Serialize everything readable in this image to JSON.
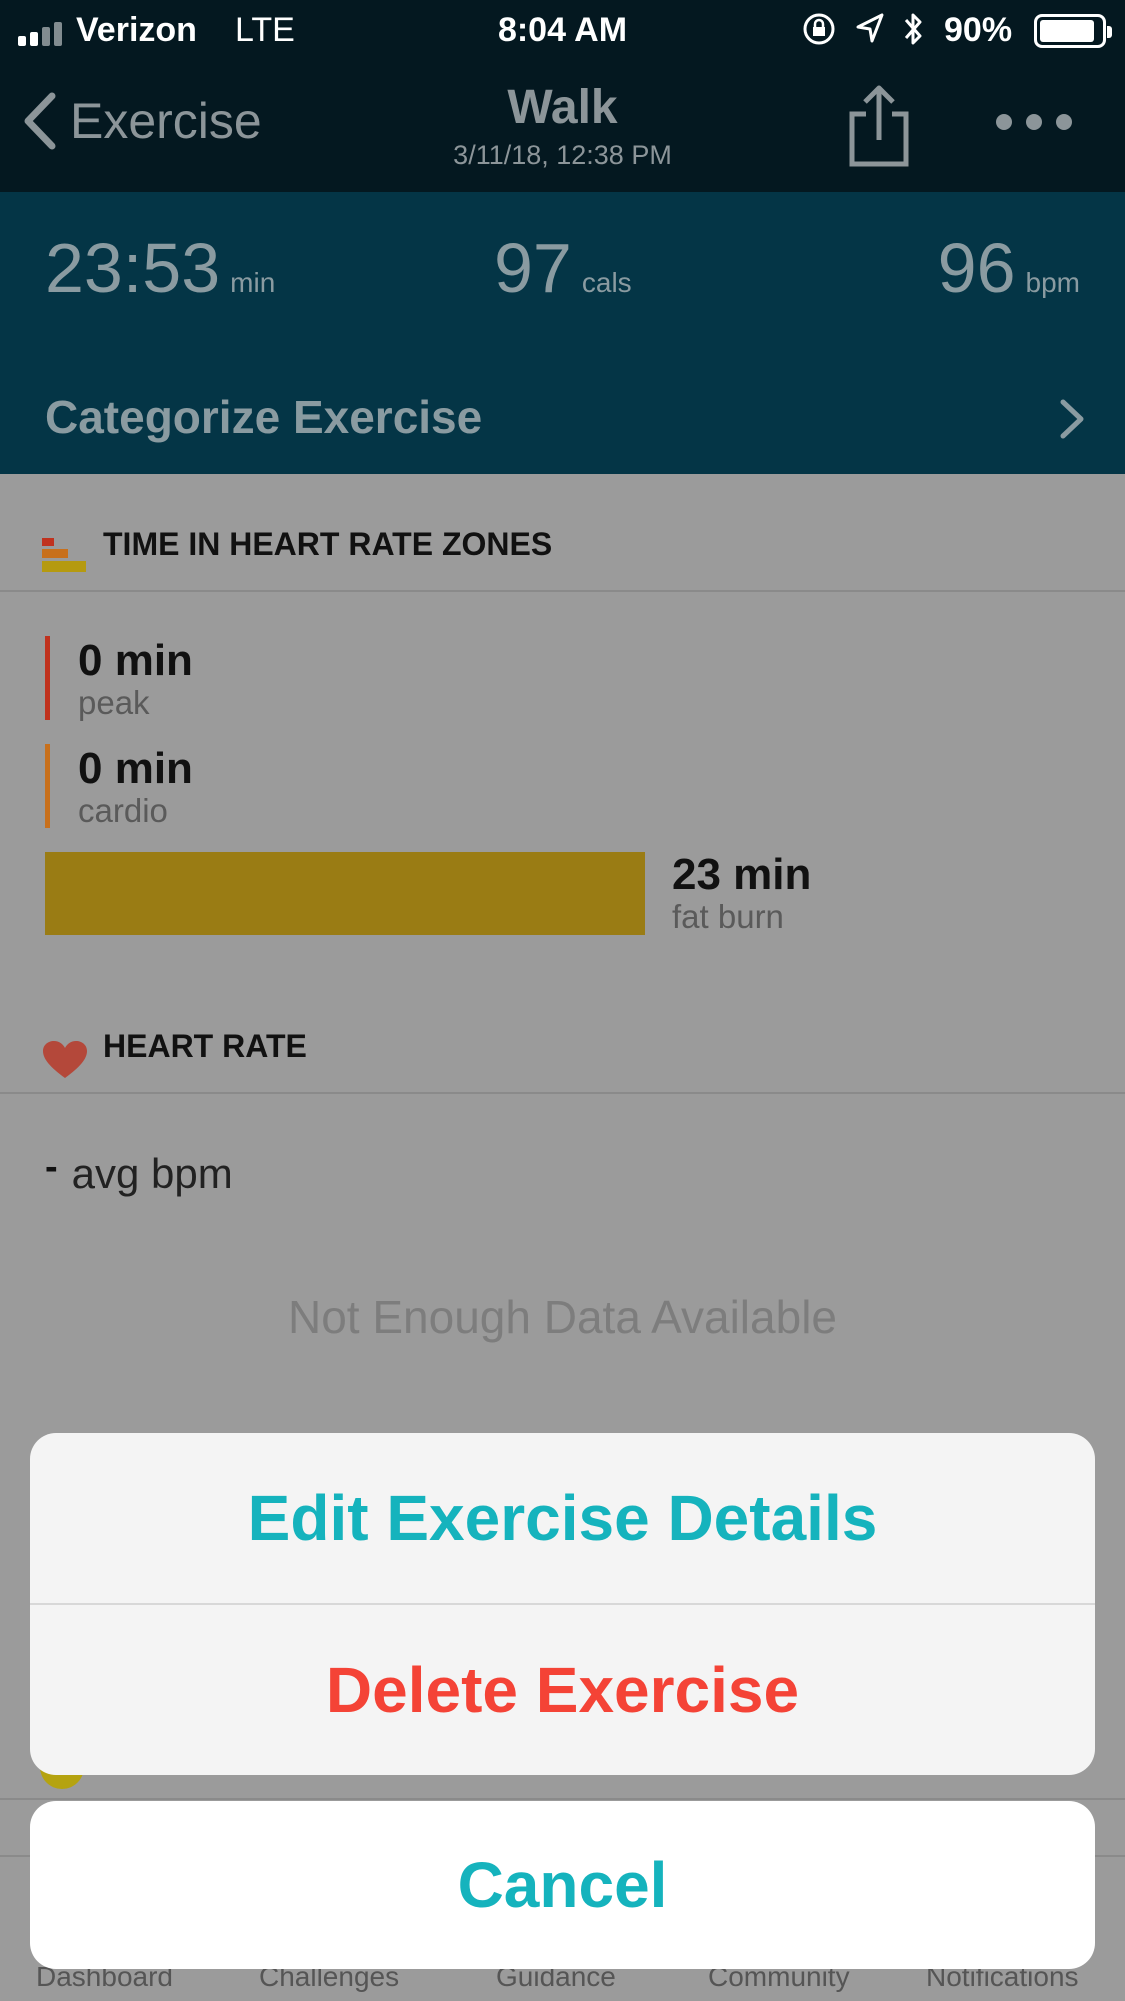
{
  "status_bar": {
    "carrier": "Verizon",
    "network": "LTE",
    "time": "8:04 AM",
    "battery": "90%",
    "battery_level": 0.9
  },
  "nav": {
    "back_label": "Exercise",
    "title": "Walk",
    "subtitle": "3/11/18, 12:38 PM"
  },
  "stats": [
    {
      "value": "23:53",
      "unit": "min"
    },
    {
      "value": "97",
      "unit": "cals"
    },
    {
      "value": "96",
      "unit": "bpm"
    }
  ],
  "categorize_label": "Categorize Exercise",
  "hr_zones": {
    "title": "TIME IN HEART RATE ZONES",
    "zones": [
      {
        "minutes": "0 min",
        "name": "peak"
      },
      {
        "minutes": "0 min",
        "name": "cardio"
      },
      {
        "minutes": "23 min",
        "name": "fat burn"
      }
    ]
  },
  "heart_rate": {
    "title": "HEART RATE",
    "avg_value": "-",
    "avg_label": "avg bpm",
    "no_data": "Not Enough Data Available"
  },
  "action_sheet": {
    "edit_label": "Edit Exercise Details",
    "delete_label": "Delete Exercise",
    "cancel_label": "Cancel"
  },
  "tabs": [
    "Dashboard",
    "Challenges",
    "Guidance",
    "Community",
    "Notifications"
  ],
  "colors": {
    "accent": "#15b3bd",
    "destructive": "#f44336",
    "peak": "#c0321e",
    "cardio": "#c8701c",
    "fat_burn": "#9a7c14"
  }
}
